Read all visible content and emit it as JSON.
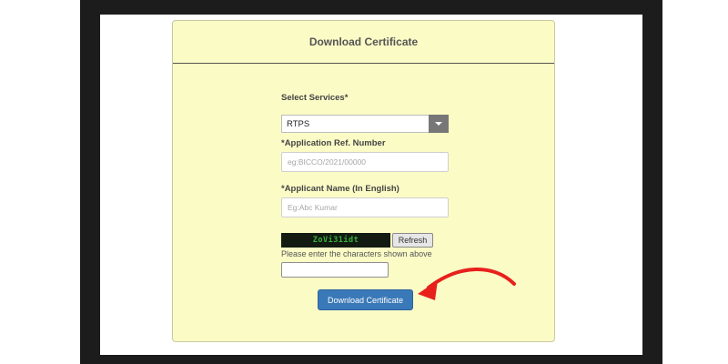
{
  "form": {
    "title": "Download Certificate",
    "select_services_label": "Select Services*",
    "select_services_value": "RTPS",
    "app_ref_label": "*Application Ref. Number",
    "app_ref_placeholder": "eg:BICCO/2021/00000",
    "applicant_name_label": "*Applicant Name (In English)",
    "applicant_name_placeholder": "Eg:Abc Kumar",
    "captcha_text": "ZoVi31idt",
    "refresh_label": "Refresh",
    "captcha_hint": "Please enter the characters shown above",
    "captcha_input_value": "",
    "submit_label": "Download Certificate"
  },
  "icons": {
    "dropdown": "chevron-down-icon",
    "annotation": "red-arrow-icon"
  },
  "colors": {
    "panel_bg": "#fbfbc6",
    "button_blue": "#3a79b8",
    "arrow_red": "#e8201c",
    "captcha_green": "#37b13a"
  }
}
